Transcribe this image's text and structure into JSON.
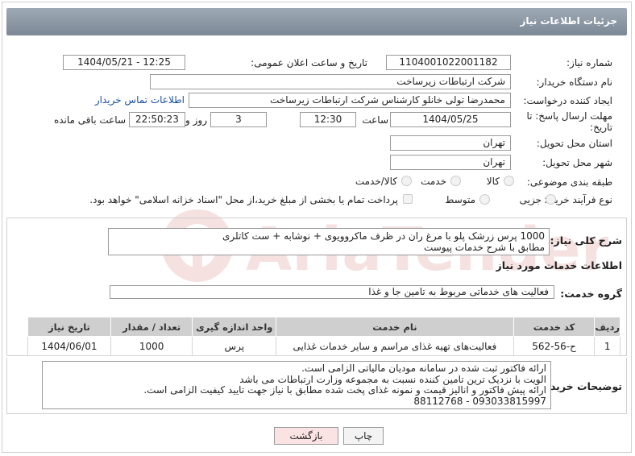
{
  "header": {
    "title": "جزئیات اطلاعات نیاز"
  },
  "fields": {
    "need_number_label": "شماره نیاز:",
    "need_number": "1104001022001182",
    "announce_label": "تاریخ و ساعت اعلان عمومی:",
    "announce_value": "1404/05/21 - 12:25",
    "buyer_org_label": "نام دستگاه خریدار:",
    "buyer_org": "شرکت ارتباطات زیرساخت",
    "creator_label": "ایجاد کننده درخواست:",
    "creator": "محمدرضا تولی خانلو کارشناس شرکت ارتباطات زیرساخت",
    "contact_link": "اطلاعات تماس خریدار",
    "deadline_label": "مهلت ارسال پاسخ: تا",
    "deadline_label2": "تاریخ:",
    "deadline_date": "1404/05/25",
    "time_label": "ساعت",
    "deadline_time": "12:30",
    "days_value": "3",
    "days_label": "روز و",
    "remaining_time": "22:50:23",
    "remaining_label": "ساعت باقی مانده",
    "province_label": "استان محل تحویل:",
    "province": "تهران",
    "city_label": "شهر محل تحویل:",
    "city": "تهران",
    "category_label": "طبقه بندی موضوعی:",
    "category_options": [
      "کالا",
      "خدمت",
      "کالا/خدمت"
    ],
    "process_label": "نوع فرآیند خرید :",
    "process_options": [
      "جزیی",
      "متوسط"
    ],
    "payment_note": "پرداخت تمام یا بخشی از مبلغ خرید،از محل \"اسناد خزانه اسلامی\" خواهد بود."
  },
  "summary": {
    "label": "شرح کلی نیاز:",
    "lines": [
      "1000 پرس زرشک پلو با مرغ ران در ظرف ماکروویوی + نوشابه + ست کاتلری",
      "مطابق با شرح خدمات پیوست"
    ]
  },
  "services_section": {
    "title": "اطلاعات خدمات مورد نیاز",
    "group_label": "گروه خدمت:",
    "group_value": "فعالیت های خدماتی مربوط به تامین جا و غذا"
  },
  "table": {
    "headers": [
      "ردیف",
      "کد خدمت",
      "نام خدمت",
      "واحد اندازه گیری",
      "تعداد / مقدار",
      "تاریخ نیاز"
    ],
    "rows": [
      [
        "1",
        "ح-56-562",
        "فعالیت‌های تهیه غذای مراسم و سایر خدمات غذایی",
        "پرس",
        "1000",
        "1404/06/01"
      ]
    ]
  },
  "buyer_notes": {
    "label": "توضیحات خریدار:",
    "lines": [
      "ارائه فاکتور ثبت شده در سامانه مودیان مالیاتی الزامی است.",
      "الویت با نزدیک ترین تامین کننده نسبت به مجموعه وزارت ارتباطات می باشد",
      "ارائه پیش فاکتور و انالیز قیمت و نمونه غذای پخت شده مطابق با نیاز جهت تایید کیفیت الزامی است.",
      "88112768 - 093033815997"
    ]
  },
  "buttons": {
    "print": "چاپ",
    "back": "بازگشت"
  },
  "watermark": {
    "text": "AriaTender.neT"
  },
  "colors": {
    "header_bg": "#8e99a7",
    "link": "#1a4fa0",
    "watermark": "#c0392b"
  }
}
